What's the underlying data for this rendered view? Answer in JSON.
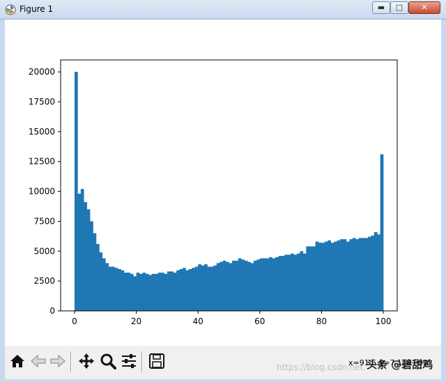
{
  "window": {
    "title": "Figure 1",
    "minimize_glyph": "▬",
    "maximize_glyph": "□",
    "close_glyph": "✕"
  },
  "toolbar": {
    "buttons": [
      {
        "name": "home-button",
        "icon": "home-icon"
      },
      {
        "name": "back-button",
        "icon": "arrow-left-icon"
      },
      {
        "name": "forward-button",
        "icon": "arrow-right-icon"
      },
      {
        "name": "pan-button",
        "icon": "move-icon"
      },
      {
        "name": "zoom-button",
        "icon": "magnifier-icon"
      },
      {
        "name": "configure-subplots-button",
        "icon": "sliders-icon"
      },
      {
        "name": "save-button",
        "icon": "floppy-disk-icon"
      }
    ],
    "coords": "x=91.5  y=7.11e+03"
  },
  "watermark": "https://blog.csdn.net",
  "badge": "头条 @碧甜鸡",
  "colors": {
    "bar": "#1f77b4",
    "axis": "#000000"
  },
  "chart_data": {
    "type": "bar",
    "title": "",
    "xlabel": "",
    "ylabel": "",
    "xlim": [
      -4.5,
      104.5
    ],
    "ylim": [
      0,
      21000
    ],
    "bins": {
      "start": 0,
      "end": 100,
      "count": 100
    },
    "xticks": [
      0,
      20,
      40,
      60,
      80,
      100
    ],
    "yticks": [
      0,
      2500,
      5000,
      7500,
      10000,
      12500,
      15000,
      17500,
      20000
    ],
    "values": [
      20000,
      9800,
      10200,
      9100,
      8500,
      7500,
      6500,
      5600,
      4900,
      4400,
      4000,
      3700,
      3700,
      3600,
      3500,
      3400,
      3200,
      3200,
      3100,
      2900,
      3200,
      3100,
      3200,
      3100,
      3000,
      3100,
      3100,
      3200,
      3200,
      3100,
      3300,
      3300,
      3200,
      3400,
      3500,
      3600,
      3400,
      3500,
      3600,
      3700,
      3900,
      3800,
      3900,
      3700,
      3700,
      3800,
      4000,
      4100,
      4200,
      4100,
      4000,
      4200,
      4200,
      4400,
      4300,
      4200,
      4100,
      4000,
      4200,
      4300,
      4400,
      4400,
      4400,
      4500,
      4400,
      4500,
      4600,
      4600,
      4700,
      4700,
      4800,
      4700,
      4800,
      5000,
      4800,
      5400,
      5400,
      5400,
      5800,
      5700,
      5700,
      5800,
      5900,
      5700,
      5800,
      5900,
      6000,
      6000,
      5800,
      6000,
      6100,
      6000,
      6100,
      6100,
      6100,
      6200,
      6300,
      6600,
      6400,
      13100
    ]
  }
}
